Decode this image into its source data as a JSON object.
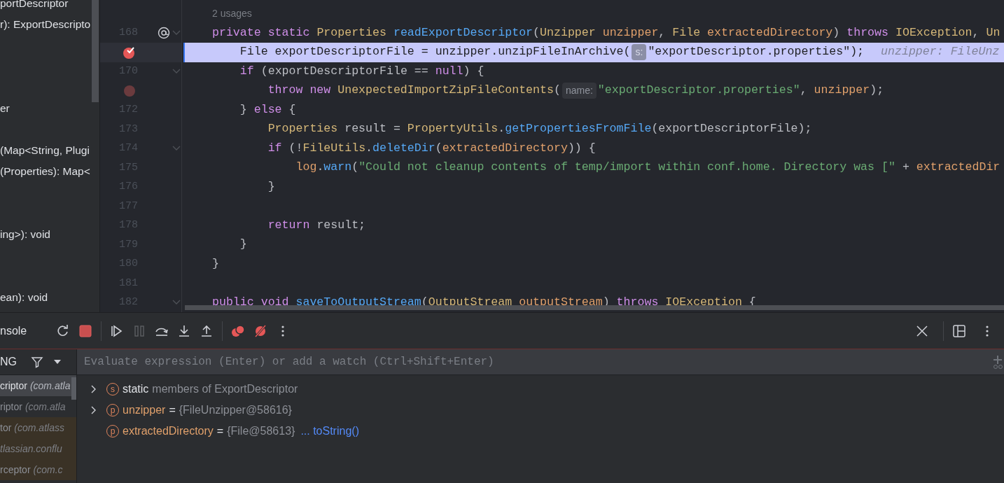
{
  "structure": {
    "items": [
      {
        "text": "portDescriptor"
      },
      {
        "text": "r): ExportDescripto"
      },
      {
        "text": "er"
      },
      {
        "text": "(Map<String, Plugi"
      },
      {
        "text": "(Properties): Map<"
      },
      {
        "text": "ing>): void"
      },
      {
        "text": "ean): void"
      }
    ]
  },
  "editor": {
    "usages": "2 usages",
    "lines": [
      {
        "number": "168",
        "implements": true,
        "breakpoint": false,
        "fold": true,
        "current": false,
        "tokens": [
          {
            "kind": "keyword",
            "text": "private static "
          },
          {
            "kind": "type",
            "text": "Properties "
          },
          {
            "kind": "function",
            "text": "readExportDescriptor"
          },
          {
            "kind": "plain",
            "text": "("
          },
          {
            "kind": "type",
            "text": "Unzipper "
          },
          {
            "kind": "param",
            "text": "unzipper"
          },
          {
            "kind": "plain",
            "text": ", "
          },
          {
            "kind": "type",
            "text": "File "
          },
          {
            "kind": "param",
            "text": "extractedDirectory"
          },
          {
            "kind": "plain",
            "text": ") "
          },
          {
            "kind": "keyword",
            "text": "throws "
          },
          {
            "kind": "type",
            "text": "IOException"
          },
          {
            "kind": "plain",
            "text": ", "
          },
          {
            "kind": "type",
            "text": "Un"
          }
        ]
      },
      {
        "implements": false,
        "breakpoint": true,
        "fold": false,
        "current": true,
        "tokens": [
          {
            "kind": "plain",
            "text": "    File exportDescriptorFile = unzipper.unzipFileInArchive("
          },
          {
            "kind": "hint",
            "text": "s:"
          },
          {
            "kind": "plain",
            "text": "\"exportDescriptor.properties\");"
          },
          {
            "kind": "inline-value",
            "text": "unzipper: FileUnz"
          }
        ]
      },
      {
        "number": "170",
        "implements": false,
        "breakpoint": false,
        "fold": true,
        "current": false,
        "tokens": [
          {
            "kind": "keyword",
            "text": "    if "
          },
          {
            "kind": "plain",
            "text": "(exportDescriptorFile == "
          },
          {
            "kind": "keyword",
            "text": "null"
          },
          {
            "kind": "plain",
            "text": ") {"
          }
        ]
      },
      {
        "implements": false,
        "breakpoint": true,
        "fold": false,
        "current": false,
        "tokens": [
          {
            "kind": "keyword",
            "text": "        throw new "
          },
          {
            "kind": "type",
            "text": "UnexpectedImportZipFileContents"
          },
          {
            "kind": "plain",
            "text": "("
          },
          {
            "kind": "hint",
            "text": "name:"
          },
          {
            "kind": "string",
            "text": "\"exportDescriptor.properties\""
          },
          {
            "kind": "plain",
            "text": ", "
          },
          {
            "kind": "param",
            "text": "unzipper"
          },
          {
            "kind": "plain",
            "text": ");"
          }
        ]
      },
      {
        "number": "172",
        "implements": false,
        "breakpoint": false,
        "fold": false,
        "current": false,
        "tokens": [
          {
            "kind": "plain",
            "text": "    } "
          },
          {
            "kind": "keyword",
            "text": "else "
          },
          {
            "kind": "plain",
            "text": "{"
          }
        ]
      },
      {
        "number": "173",
        "implements": false,
        "breakpoint": false,
        "fold": false,
        "current": false,
        "tokens": [
          {
            "kind": "type",
            "text": "        Properties "
          },
          {
            "kind": "plain",
            "text": "result = "
          },
          {
            "kind": "type",
            "text": "PropertyUtils"
          },
          {
            "kind": "plain",
            "text": "."
          },
          {
            "kind": "function",
            "text": "getPropertiesFromFile"
          },
          {
            "kind": "plain",
            "text": "(exportDescriptorFile);"
          }
        ]
      },
      {
        "number": "174",
        "implements": false,
        "breakpoint": false,
        "fold": true,
        "current": false,
        "tokens": [
          {
            "kind": "keyword",
            "text": "        if "
          },
          {
            "kind": "plain",
            "text": "(!"
          },
          {
            "kind": "type",
            "text": "FileUtils"
          },
          {
            "kind": "plain",
            "text": "."
          },
          {
            "kind": "function",
            "text": "deleteDir"
          },
          {
            "kind": "plain",
            "text": "("
          },
          {
            "kind": "param",
            "text": "extractedDirectory"
          },
          {
            "kind": "plain",
            "text": ")) {"
          }
        ]
      },
      {
        "number": "175",
        "implements": false,
        "breakpoint": false,
        "fold": false,
        "current": false,
        "tokens": [
          {
            "kind": "param",
            "text": "            log"
          },
          {
            "kind": "plain",
            "text": "."
          },
          {
            "kind": "function",
            "text": "warn"
          },
          {
            "kind": "plain",
            "text": "("
          },
          {
            "kind": "string",
            "text": "\"Could not cleanup contents of temp/import within conf.home. Directory was [\""
          },
          {
            "kind": "plain",
            "text": " + "
          },
          {
            "kind": "param",
            "text": "extractedDir"
          }
        ]
      },
      {
        "number": "176",
        "implements": false,
        "breakpoint": false,
        "fold": false,
        "current": false,
        "tokens": [
          {
            "kind": "plain",
            "text": "        }"
          }
        ]
      },
      {
        "number": "177",
        "implements": false,
        "breakpoint": false,
        "fold": false,
        "current": false
      },
      {
        "number": "178",
        "implements": false,
        "breakpoint": false,
        "fold": false,
        "current": false,
        "tokens": [
          {
            "kind": "keyword",
            "text": "        return "
          },
          {
            "kind": "plain",
            "text": "result;"
          }
        ]
      },
      {
        "number": "179",
        "implements": false,
        "breakpoint": false,
        "fold": false,
        "current": false,
        "tokens": [
          {
            "kind": "plain",
            "text": "    }"
          }
        ]
      },
      {
        "number": "180",
        "implements": false,
        "breakpoint": false,
        "fold": false,
        "current": false,
        "tokens": [
          {
            "kind": "plain",
            "text": "}"
          }
        ]
      },
      {
        "number": "181",
        "implements": false,
        "breakpoint": false,
        "fold": false,
        "current": false
      },
      {
        "number": "182",
        "implements": false,
        "breakpoint": false,
        "fold": true,
        "current": false,
        "tokens": [
          {
            "kind": "keyword",
            "text": "public void "
          },
          {
            "kind": "function",
            "text": "saveToOutputStream"
          },
          {
            "kind": "plain",
            "text": "("
          },
          {
            "kind": "type",
            "text": "OutputStream "
          },
          {
            "kind": "param",
            "text": "outputStream"
          },
          {
            "kind": "plain",
            "text": ") "
          },
          {
            "kind": "keyword",
            "text": "throws "
          },
          {
            "kind": "type",
            "text": "IOException "
          },
          {
            "kind": "plain",
            "text": "{"
          }
        ]
      }
    ]
  },
  "debug_toolbar": {
    "tab": "nsole",
    "tools": [
      {
        "kind": "rerun",
        "disabled": false
      },
      {
        "kind": "stop",
        "disabled": false
      },
      {
        "kind": "separator"
      },
      {
        "kind": "resume",
        "disabled": false
      },
      {
        "kind": "pause",
        "disabled": true
      },
      {
        "kind": "step-over",
        "disabled": false
      },
      {
        "kind": "step-into",
        "disabled": false
      },
      {
        "kind": "step-out",
        "disabled": false
      },
      {
        "kind": "separator"
      },
      {
        "kind": "breakpoints",
        "disabled": false
      },
      {
        "kind": "mute",
        "disabled": false
      },
      {
        "kind": "more",
        "disabled": false
      }
    ],
    "right_tools": [
      {
        "kind": "close"
      },
      {
        "kind": "separator"
      },
      {
        "kind": "layout"
      },
      {
        "kind": "more"
      }
    ]
  },
  "frames": {
    "thread": "NG",
    "items": [
      {
        "name": "criptor",
        "package": "(com.atla",
        "selected": true,
        "library": false
      },
      {
        "name": "riptor",
        "package": "(com.atla",
        "selected": false,
        "library": false
      },
      {
        "name": "tor",
        "package": "(com.atlass",
        "selected": false,
        "library": true
      },
      {
        "package": "tlassian.conflu",
        "selected": false,
        "library": true
      },
      {
        "name": "rceptor",
        "package": "(com.c",
        "selected": false,
        "library": true
      }
    ]
  },
  "evaluate": {
    "placeholder": "Evaluate expression (Enter) or add a watch (Ctrl+Shift+Enter)"
  },
  "variables": [
    {
      "kind": "static",
      "badge": "s",
      "expandable": true,
      "name": "static",
      "detail": "members of ExportDescriptor"
    },
    {
      "kind": "param",
      "badge": "p",
      "expandable": true,
      "name": "unzipper",
      "operator": "=",
      "value": "{FileUnzipper@58616}"
    },
    {
      "kind": "param",
      "badge": "p",
      "expandable": false,
      "name": "extractedDirectory",
      "operator": "=",
      "value": "{File@58613}",
      "link": "... toString()"
    }
  ]
}
